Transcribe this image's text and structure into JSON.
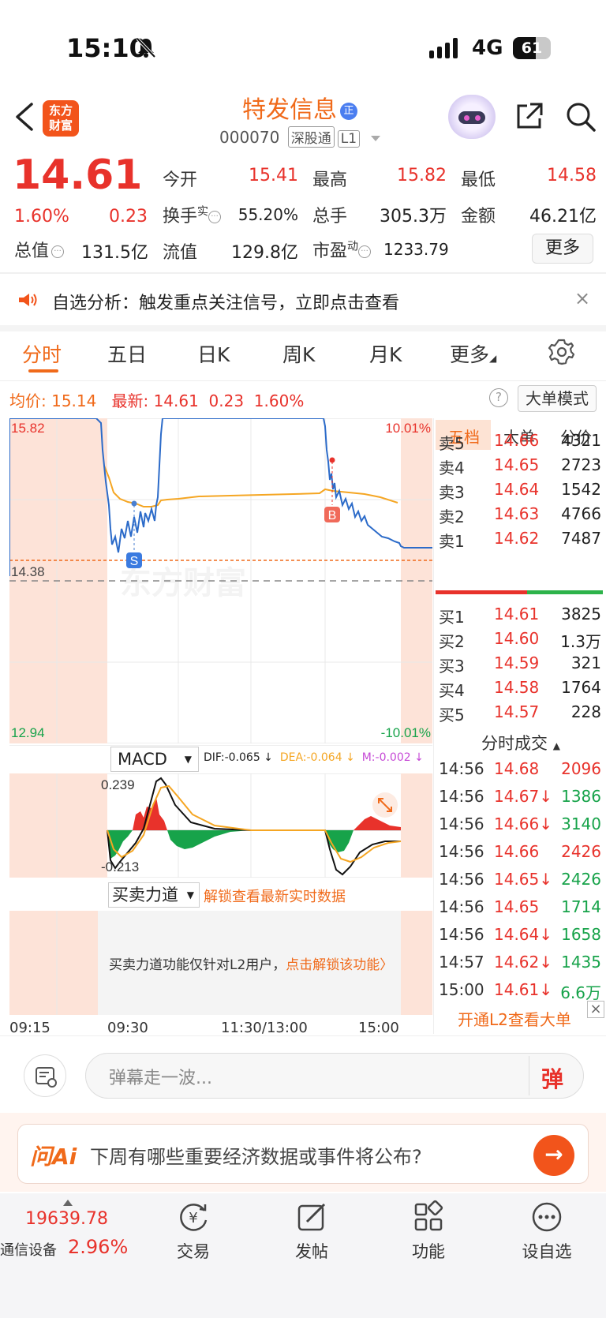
{
  "status_bar": {
    "time": "15:10",
    "network": "4G",
    "battery": "61",
    "battery_level_pct": 61
  },
  "header": {
    "logo": "东方\n财富",
    "title": "特发信息",
    "title_badge": "正",
    "code": "000070",
    "tag1": "深股通",
    "tag2": "L1"
  },
  "quote": {
    "price": "14.61",
    "pct": "1.60%",
    "chg": "0.23",
    "labels": {
      "open": "今开",
      "high": "最高",
      "low": "最低",
      "turnover": "换手",
      "turnover_sup": "实",
      "volume": "总手",
      "amount": "金额",
      "mcap": "总值",
      "float": "流值",
      "pe": "市盈",
      "pe_sup": "动"
    },
    "values": {
      "open": "15.41",
      "high": "15.82",
      "low": "14.58",
      "turnover": "55.20%",
      "volume": "305.3万",
      "amount": "46.21亿",
      "mcap": "131.5亿",
      "float": "129.8亿",
      "pe": "1233.79"
    },
    "more": "更多"
  },
  "notice": {
    "text": "自选分析：触发重点关注信号，立即点击查看",
    "close": "×"
  },
  "tabs": [
    {
      "label": "分时",
      "active": true
    },
    {
      "label": "五日"
    },
    {
      "label": "日K"
    },
    {
      "label": "周K"
    },
    {
      "label": "月K"
    },
    {
      "label": "更多"
    }
  ],
  "avg_row": {
    "avg_label": "均价:",
    "avg": "15.14",
    "latest_label": "最新:",
    "latest": "14.61",
    "chg": "0.23",
    "pct": "1.60%",
    "help": "?",
    "big_order": "大单模式"
  },
  "chart": {
    "y_top": "15.82",
    "y_mid": "14.38",
    "y_bot": "12.94",
    "pct_top": "10.01%",
    "pct_bot": "-10.01%",
    "watermark": "东方财富",
    "marker_s": "S",
    "marker_b": "B",
    "time_labels": [
      "09:15",
      "09:30",
      "11:30/13:00",
      "15:00"
    ],
    "colors": {
      "price": "#2c6bc9",
      "avg": "#f5a623",
      "up": "#e8322b",
      "down": "#17a34a"
    }
  },
  "macd": {
    "label": "MACD",
    "dif": "DIF:-0.065 ↓",
    "dea": "DEA:-0.064 ↓",
    "m": "M:-0.002 ↓",
    "top": "0.239",
    "bot": "-0.213"
  },
  "buysell": {
    "label": "买卖力道",
    "unlock": "解锁查看最新实时数据",
    "msg": "买卖力道功能仅针对L2用户，",
    "msg_link": "点击解锁该功能〉"
  },
  "orderbook": {
    "tabs": [
      "五档",
      "大单",
      "分价"
    ],
    "asks": [
      {
        "label": "卖5",
        "price": "14.66",
        "vol": "4321"
      },
      {
        "label": "卖4",
        "price": "14.65",
        "vol": "2723"
      },
      {
        "label": "卖3",
        "price": "14.64",
        "vol": "1542"
      },
      {
        "label": "卖2",
        "price": "14.63",
        "vol": "4766"
      },
      {
        "label": "卖1",
        "price": "14.62",
        "vol": "7487"
      }
    ],
    "bids": [
      {
        "label": "买1",
        "price": "14.61",
        "vol": "3825"
      },
      {
        "label": "买2",
        "price": "14.60",
        "vol": "1.3万"
      },
      {
        "label": "买3",
        "price": "14.59",
        "vol": "321"
      },
      {
        "label": "买4",
        "price": "14.58",
        "vol": "1764"
      },
      {
        "label": "买5",
        "price": "14.57",
        "vol": "228"
      }
    ],
    "trades_title": "分时成交",
    "trades": [
      {
        "time": "14:56",
        "price": "14.68",
        "vol": "2096",
        "dir": "up"
      },
      {
        "time": "14:56",
        "price": "14.67↓",
        "vol": "1386",
        "dir": "down"
      },
      {
        "time": "14:56",
        "price": "14.66↓",
        "vol": "3140",
        "dir": "down"
      },
      {
        "time": "14:56",
        "price": "14.66",
        "vol": "2426",
        "dir": "up"
      },
      {
        "time": "14:56",
        "price": "14.65↓",
        "vol": "2426",
        "dir": "down"
      },
      {
        "time": "14:56",
        "price": "14.65",
        "vol": "1714",
        "dir": "down"
      },
      {
        "time": "14:56",
        "price": "14.64↓",
        "vol": "1658",
        "dir": "down"
      },
      {
        "time": "14:57",
        "price": "14.62↓",
        "vol": "1435",
        "dir": "down"
      },
      {
        "time": "15:00",
        "price": "14.61↓",
        "vol": "6.6万",
        "dir": "down"
      }
    ],
    "l2_open": "开通L2查看大单",
    "l2_close": "×"
  },
  "comment": {
    "placeholder": "弹幕走一波...",
    "dan": "弹"
  },
  "ai": {
    "logo": "问Ai",
    "text": "下周有哪些重要经济数据或事件将公布?",
    "go": "→"
  },
  "bottom_nav": {
    "index_value": "19639.78",
    "index_name": "通信设备",
    "index_pct": "2.96%",
    "items": [
      {
        "label": "交易",
        "icon": "trade-icon"
      },
      {
        "label": "发帖",
        "icon": "post-icon"
      },
      {
        "label": "功能",
        "icon": "apps-icon"
      },
      {
        "label": "设自选",
        "icon": "watchlist-icon"
      }
    ]
  }
}
